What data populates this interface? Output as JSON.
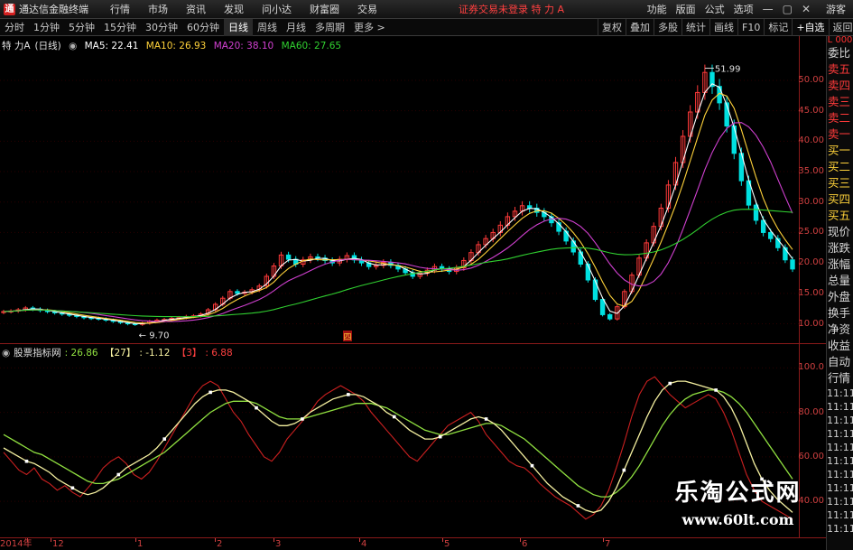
{
  "app": {
    "title": "通达信金融终端",
    "logo_letter": "通",
    "menu": [
      "行情",
      "市场",
      "资讯",
      "发现",
      "问小达",
      "财富圈",
      "交易"
    ],
    "notice": "证券交易未登录  特 力 A",
    "right_menu": [
      "功能",
      "版面",
      "公式",
      "选项"
    ],
    "guest": "游客",
    "window_buttons": [
      "—",
      "▢",
      "✕"
    ]
  },
  "tabbar": {
    "periods": [
      "分时",
      "1分钟",
      "5分钟",
      "15分钟",
      "30分钟",
      "60分钟",
      "日线",
      "周线",
      "月线",
      "多周期",
      "更多 >"
    ],
    "active": "日线",
    "tools": [
      "复权",
      "叠加",
      "多股",
      "统计",
      "画线",
      "F10",
      "标记",
      "+自选",
      "返回"
    ]
  },
  "price_legend": {
    "stock": "特 力A",
    "period": "(日线)",
    "ma5": "MA5: 22.41",
    "ma10": "MA10: 26.93",
    "ma20": "MA20: 38.10",
    "ma60": "MA60: 27.65"
  },
  "price_annotations": {
    "high": "51.99",
    "low": "9.70",
    "marker": "四"
  },
  "indicator_legend": {
    "name": "股票指标网",
    "v1": ": 26.86",
    "v2_label": "【27】",
    "v2": ": -1.12",
    "v3_label": "【3】",
    "v3": ": 6.88"
  },
  "colors": {
    "up": "#ff3a3a",
    "down": "#00e0e0",
    "ma5": "#ffffff",
    "ma10": "#ffd23a",
    "ma20": "#d040d0",
    "ma60": "#30d030",
    "axis": "#d04040",
    "ind_red": "#cc2020",
    "ind_yellow": "#f5f0a0",
    "ind_green": "#90e040"
  },
  "price_axis": {
    "ticks": [
      "50.00",
      "45.00",
      "40.00",
      "35.00",
      "30.00",
      "25.00",
      "20.00",
      "15.00",
      "10.00"
    ],
    "head": "L 000"
  },
  "ind_axis": {
    "ticks": [
      "100.0",
      "80.00",
      "60.00",
      "40.00"
    ]
  },
  "date_axis": [
    "2014年",
    "12",
    "1",
    "2",
    "3",
    "4",
    "5",
    "6",
    "7"
  ],
  "side_panel": {
    "items": [
      "委比",
      "卖五",
      "卖四",
      "卖三",
      "卖二",
      "卖一",
      "买一",
      "买二",
      "买三",
      "买四",
      "买五",
      "现价",
      "涨跌",
      "涨幅",
      "总量",
      "外盘",
      "换手",
      "净资",
      "收益",
      "自动",
      "行情"
    ],
    "times": [
      "11:11",
      "11:11",
      "11:11",
      "11:11",
      "11:11",
      "11:11",
      "11:11",
      "11:11",
      "11:11",
      "11:11",
      "11:11"
    ]
  },
  "watermark": {
    "cn": "乐淘公式网",
    "url": "www.60lt.com"
  },
  "chart_data": {
    "type": "candlestick",
    "title": "特 力A (日线)",
    "ylim": [
      8,
      54
    ],
    "series_ma": [
      {
        "name": "MA5",
        "value": 22.41
      },
      {
        "name": "MA10",
        "value": 26.93
      },
      {
        "name": "MA20",
        "value": 38.1
      },
      {
        "name": "MA60",
        "value": 27.65
      }
    ],
    "close_path": [
      12,
      12.1,
      12.3,
      12.6,
      12.4,
      12.2,
      12.0,
      11.8,
      11.6,
      11.4,
      11.2,
      11.0,
      10.9,
      10.8,
      10.6,
      10.4,
      10.2,
      10.0,
      9.9,
      10.1,
      10.4,
      10.6,
      10.7,
      10.9,
      11.0,
      11.2,
      11.3,
      11.6,
      12.3,
      13.2,
      14.2,
      15.3,
      15.0,
      15.2,
      15.6,
      16.2,
      17.8,
      19.5,
      21.3,
      20.6,
      19.8,
      20.5,
      21.0,
      20.8,
      20.4,
      20.0,
      20.6,
      21.2,
      20.5,
      20.0,
      19.4,
      19.6,
      20.1,
      19.6,
      19.0,
      18.4,
      17.8,
      18.3,
      18.8,
      19.4,
      19.0,
      18.6,
      19.2,
      20.4,
      21.7,
      23.0,
      24.0,
      25.0,
      26.2,
      27.6,
      28.5,
      29.4,
      29.0,
      28.3,
      27.6,
      26.6,
      25.2,
      23.6,
      21.8,
      19.8,
      17.2,
      14.0,
      11.5,
      10.8,
      12.8,
      15.3,
      18.0,
      20.8,
      23.3,
      26.0,
      29.0,
      32.8,
      36.5,
      40.8,
      44.8,
      48.0,
      51.3,
      49.0,
      46.3,
      42.5,
      38.0,
      33.5,
      29.5,
      27.0,
      25.0,
      24.0,
      22.5,
      20.5,
      19.0
    ],
    "low_label": 9.7,
    "high_label": 51.99,
    "indicator": {
      "name": "股票指标网",
      "ylim": [
        25,
        105
      ],
      "ticks": [
        100,
        80,
        60,
        40
      ],
      "red": [
        62,
        58,
        54,
        52,
        55,
        50,
        48,
        45,
        47,
        44,
        42,
        46,
        50,
        55,
        58,
        60,
        57,
        52,
        50,
        53,
        58,
        64,
        70,
        76,
        82,
        88,
        92,
        94,
        92,
        86,
        80,
        76,
        70,
        65,
        60,
        58,
        62,
        68,
        72,
        76,
        80,
        85,
        88,
        90,
        92,
        90,
        88,
        85,
        80,
        76,
        72,
        68,
        64,
        60,
        58,
        62,
        66,
        70,
        74,
        76,
        78,
        80,
        76,
        70,
        66,
        62,
        58,
        56,
        55,
        52,
        48,
        45,
        42,
        40,
        38,
        35,
        32,
        34,
        38,
        45,
        55,
        66,
        78,
        88,
        94,
        96,
        92,
        88,
        85,
        82,
        84,
        86,
        88,
        86,
        80,
        72,
        62,
        52,
        45,
        40,
        38,
        36,
        34,
        32
      ],
      "yellow": [
        64,
        62,
        60,
        58,
        57,
        55,
        53,
        50,
        48,
        46,
        44,
        43,
        44,
        46,
        49,
        52,
        55,
        57,
        59,
        61,
        64,
        68,
        72,
        76,
        80,
        84,
        87,
        89,
        90,
        90,
        89,
        87,
        85,
        82,
        79,
        76,
        74,
        74,
        75,
        77,
        80,
        82,
        84,
        86,
        87,
        88,
        88,
        87,
        85,
        83,
        80,
        78,
        75,
        72,
        70,
        68,
        68,
        69,
        71,
        73,
        75,
        77,
        78,
        77,
        75,
        72,
        68,
        64,
        60,
        56,
        52,
        48,
        45,
        42,
        40,
        38,
        36,
        35,
        36,
        40,
        46,
        54,
        62,
        70,
        78,
        85,
        90,
        93,
        94,
        94,
        93,
        92,
        91,
        90,
        87,
        82,
        75,
        66,
        57,
        50,
        45,
        41,
        38,
        35
      ],
      "green": [
        70,
        68,
        66,
        64,
        62,
        61,
        59,
        57,
        55,
        53,
        51,
        49,
        48,
        48,
        49,
        50,
        52,
        54,
        56,
        58,
        60,
        62,
        65,
        68,
        71,
        74,
        77,
        80,
        82,
        84,
        85,
        85,
        85,
        84,
        82,
        80,
        78,
        77,
        77,
        77,
        78,
        79,
        80,
        81,
        82,
        83,
        84,
        84,
        84,
        83,
        82,
        80,
        78,
        76,
        74,
        72,
        71,
        70,
        70,
        71,
        72,
        73,
        74,
        75,
        75,
        74,
        72,
        70,
        68,
        65,
        62,
        59,
        56,
        53,
        50,
        47,
        45,
        43,
        42,
        42,
        44,
        47,
        51,
        56,
        62,
        68,
        74,
        79,
        83,
        86,
        88,
        89,
        90,
        90,
        89,
        87,
        84,
        80,
        75,
        70,
        65,
        60,
        55,
        50
      ]
    }
  }
}
